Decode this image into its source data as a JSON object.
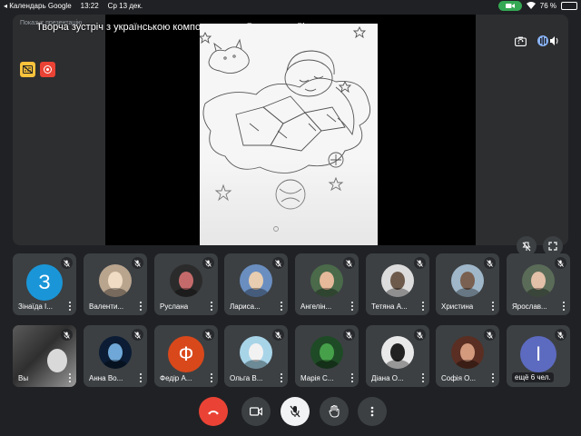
{
  "status_bar": {
    "back_app": "◂ Календарь Google",
    "time": "13:22",
    "date": "Ср 13 дек.",
    "battery": "76 %"
  },
  "meeting": {
    "title": "Творча зустріч з українською композиторкою Русланою Лісовою",
    "presenter_caption": "Показує презентацію"
  },
  "participants_row1": [
    {
      "name": "Зінаїда І...",
      "avatar_letter": "З",
      "avatar_color": "#1a96d8",
      "type": "letter"
    },
    {
      "name": "Валенти...",
      "type": "photo",
      "photo_bg": "#b9a48e",
      "photo_fg": "#f0dcc4"
    },
    {
      "name": "Руслана",
      "type": "photo",
      "photo_bg": "#2b2b2b",
      "photo_fg": "#c56a6a"
    },
    {
      "name": "Лариса...",
      "type": "photo",
      "photo_bg": "#6a8ec0",
      "photo_fg": "#e8cdb0"
    },
    {
      "name": "Ангелін...",
      "type": "photo",
      "photo_bg": "#4a6a4a",
      "photo_fg": "#e5b99a"
    },
    {
      "name": "Тетяна А...",
      "type": "photo",
      "photo_bg": "#dcdcdc",
      "photo_fg": "#6d5a4a"
    },
    {
      "name": "Христина",
      "type": "photo",
      "photo_bg": "#9fb7c9",
      "photo_fg": "#7a6050"
    },
    {
      "name": "Ярослав...",
      "type": "photo",
      "photo_bg": "#5a6c58",
      "photo_fg": "#e3c0a8"
    }
  ],
  "participants_row2": [
    {
      "name": "Вы",
      "type": "self",
      "photo_bg": "#4b4b4b",
      "photo_fg": "#d9d9d9"
    },
    {
      "name": "Анна Во...",
      "type": "photo",
      "photo_bg": "#0b1c34",
      "photo_fg": "#6fa8d8"
    },
    {
      "name": "Федір А...",
      "avatar_letter": "Ф",
      "avatar_color": "#d9481b",
      "type": "letter"
    },
    {
      "name": "Ольга В...",
      "type": "photo",
      "photo_bg": "#a8d4e8",
      "photo_fg": "#f2f2f2"
    },
    {
      "name": "Марія С...",
      "type": "photo",
      "photo_bg": "#1f4a26",
      "photo_fg": "#46a04a"
    },
    {
      "name": "Діана О...",
      "type": "photo",
      "photo_bg": "#e9e9e9",
      "photo_fg": "#222222"
    },
    {
      "name": "Софія О...",
      "type": "photo",
      "photo_bg": "#5a2e22",
      "photo_fg": "#d39a7e"
    },
    {
      "name": "ещё 6 чел.",
      "avatar_letter": "І",
      "avatar_color": "#5c6bc0",
      "type": "more"
    }
  ],
  "icons": {
    "captions": "captions-off-icon",
    "recording": "recording-icon",
    "switch_camera": "switch-camera-icon",
    "audio_output": "speaker-icon",
    "pin": "pin-off-icon",
    "fullscreen": "fullscreen-icon",
    "end_call": "end-call-icon",
    "camera": "camera-icon",
    "mic": "mic-off-icon",
    "hand": "raise-hand-icon",
    "menu": "more-vert-icon"
  },
  "colors": {
    "background": "#202124",
    "tile": "#3c4043",
    "end_call": "#ea4335",
    "captions_badge": "#f9c23c",
    "status_cam_pill": "#34a853"
  }
}
